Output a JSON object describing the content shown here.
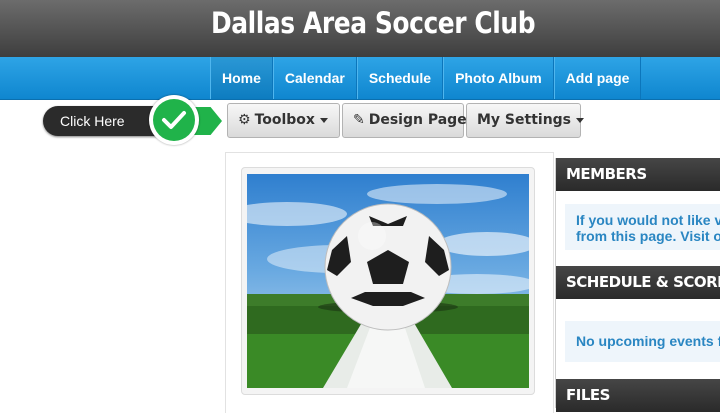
{
  "header": {
    "title": "Dallas Area Soccer Club"
  },
  "nav": {
    "items": [
      {
        "label": "Home"
      },
      {
        "label": "Calendar"
      },
      {
        "label": "Schedule"
      },
      {
        "label": "Photo Album"
      },
      {
        "label": "Add page"
      }
    ],
    "active": "Home"
  },
  "callout": {
    "label": "Click Here",
    "icon": "check-icon"
  },
  "toolbar": {
    "toolbox": {
      "label": "Toolbox",
      "icon": "gear-icon"
    },
    "design": {
      "label": "Design Page",
      "icon": "edit-icon"
    },
    "settings": {
      "label": "My Settings"
    }
  },
  "main": {
    "image": "soccer-ball-photo"
  },
  "sidebar": {
    "members": {
      "title": "MEMBERS",
      "line1": "If you would not like v",
      "line2": "from this page. Visit o"
    },
    "schedule": {
      "title": "SCHEDULE & SCORES",
      "message": "No upcoming events f"
    },
    "files": {
      "title": "FILES"
    }
  },
  "colors": {
    "header": "#4a4a4a",
    "nav": "#1b94dc",
    "callout_green": "#20b34a",
    "sidebar_text": "#2a86c2"
  }
}
